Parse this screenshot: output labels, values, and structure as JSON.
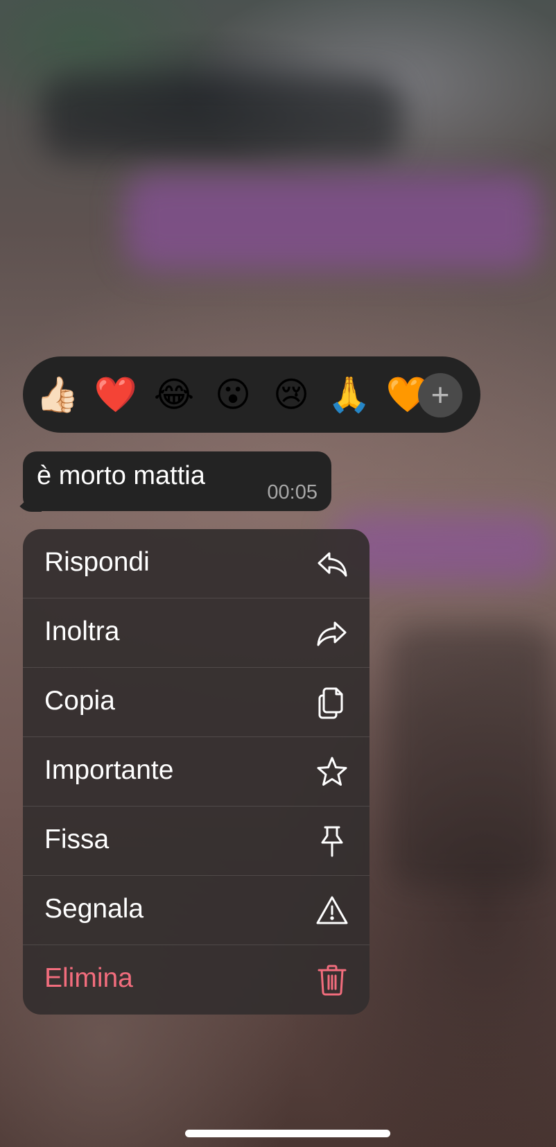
{
  "reactions": {
    "items": [
      {
        "emoji": "👍🏻",
        "name": "thumbs-up"
      },
      {
        "emoji": "❤️",
        "name": "red-heart"
      },
      {
        "emoji": "😂",
        "name": "tears-of-joy"
      },
      {
        "emoji": "😮",
        "name": "surprised"
      },
      {
        "emoji": "😢",
        "name": "crying"
      },
      {
        "emoji": "🙏",
        "name": "folded-hands"
      },
      {
        "emoji": "🧡",
        "name": "orange-heart"
      }
    ],
    "more_symbol": "+"
  },
  "message": {
    "text": "è morto mattia",
    "time": "00:05"
  },
  "menu": {
    "items": [
      {
        "label": "Rispondi",
        "icon": "reply-icon"
      },
      {
        "label": "Inoltra",
        "icon": "forward-icon"
      },
      {
        "label": "Copia",
        "icon": "copy-icon"
      },
      {
        "label": "Importante",
        "icon": "star-icon"
      },
      {
        "label": "Fissa",
        "icon": "pin-icon"
      },
      {
        "label": "Segnala",
        "icon": "warning-icon"
      },
      {
        "label": "Elimina",
        "icon": "trash-icon"
      }
    ]
  },
  "colors": {
    "menu_text": "#ffffff",
    "danger": "#f26d7d",
    "surface": "#232323"
  }
}
